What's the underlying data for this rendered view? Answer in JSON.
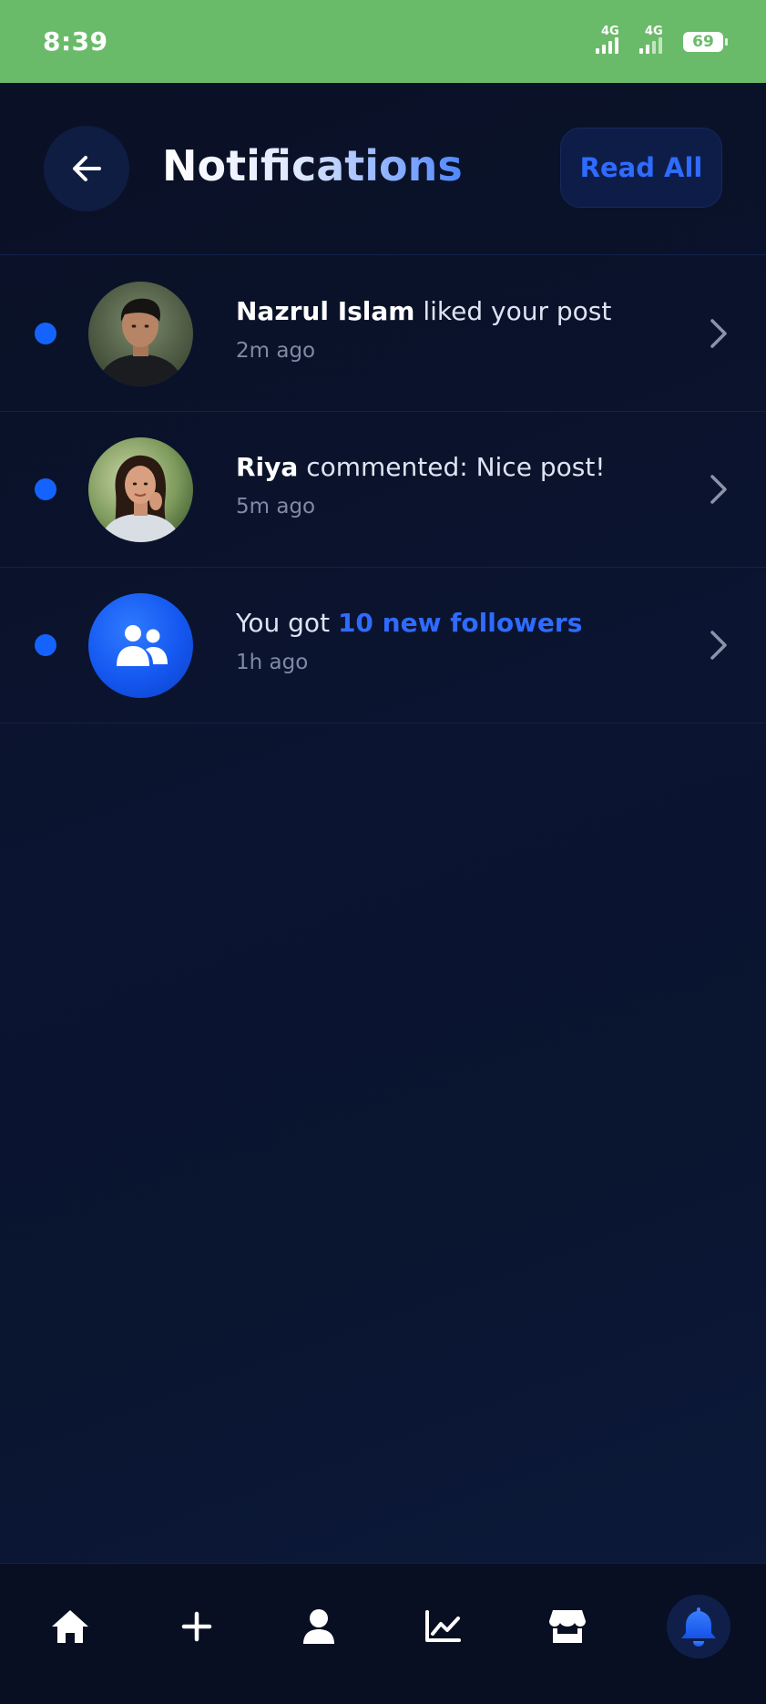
{
  "status_bar": {
    "time": "8:39",
    "network_1": "4G",
    "network_2": "4G",
    "battery": "69"
  },
  "header": {
    "title": "Notifications",
    "read_all_label": "Read All",
    "back_icon": "arrow-left-icon"
  },
  "notifications": [
    {
      "name": "Nazrul Islam",
      "action": " liked your post",
      "time": "2m ago",
      "unread": true,
      "avatar": "profile-photo-man"
    },
    {
      "name": "Riya",
      "action": " commented: Nice post!",
      "time": "5m ago",
      "unread": true,
      "avatar": "profile-photo-woman"
    },
    {
      "prefix": "You got ",
      "highlight": "10 new followers",
      "time": "1h ago",
      "unread": true,
      "avatar": "users-icon"
    }
  ],
  "bottom_nav": {
    "items": [
      "home-icon",
      "plus-icon",
      "profile-icon",
      "analytics-icon",
      "store-icon",
      "bell-icon"
    ],
    "active": "bell-icon"
  },
  "colors": {
    "status_bar": "#6abb69",
    "accent": "#2f6bff",
    "background": "#0a1128",
    "unread_dot": "#1463ff"
  }
}
